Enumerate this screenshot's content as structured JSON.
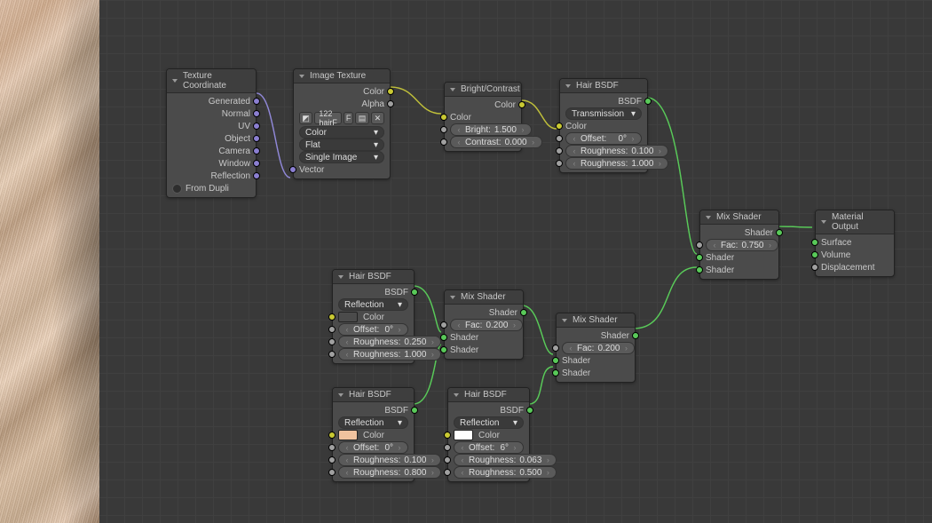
{
  "colors": {
    "swatch_hair1": "#e7d4a6",
    "swatch_hair2": "#f0c29e",
    "swatch_hair3": "#ffffff"
  },
  "nodes": {
    "tex_coord": {
      "title": "Texture Coordinate",
      "outs": [
        "Generated",
        "Normal",
        "UV",
        "Object",
        "Camera",
        "Window",
        "Reflection"
      ],
      "from_dupli": "From Dupli"
    },
    "image_tex": {
      "title": "Image Texture",
      "out_color": "Color",
      "out_alpha": "Alpha",
      "image_name": "122 hairF",
      "f": "F",
      "color_space": "Color",
      "projection": "Flat",
      "source": "Single Image",
      "in_vector": "Vector"
    },
    "bright_contrast": {
      "title": "Bright/Contrast",
      "out_color": "Color",
      "in_color": "Color",
      "bright_label": "Bright:",
      "bright_value": "1.500",
      "contrast_label": "Contrast:",
      "contrast_value": "0.000"
    },
    "hair_transmission": {
      "title": "Hair BSDF",
      "out_bsdf": "BSDF",
      "component": "Transmission",
      "in_color": "Color",
      "offset_label": "Offset:",
      "offset_value": "0°",
      "rough1_label": "Roughness:",
      "rough1_value": "0.100",
      "rough2_label": "Roughness:",
      "rough2_value": "1.000"
    },
    "hair_refl1": {
      "title": "Hair BSDF",
      "out_bsdf": "BSDF",
      "component": "Reflection",
      "in_color": "Color",
      "offset_label": "Offset:",
      "offset_value": "0°",
      "rough1_label": "Roughness:",
      "rough1_value": "0.250",
      "rough2_label": "Roughness:",
      "rough2_value": "1.000"
    },
    "hair_refl2": {
      "title": "Hair BSDF",
      "out_bsdf": "BSDF",
      "component": "Reflection",
      "in_color": "Color",
      "offset_label": "Offset:",
      "offset_value": "0°",
      "rough1_label": "Roughness:",
      "rough1_value": "0.100",
      "rough2_label": "Roughness:",
      "rough2_value": "0.800"
    },
    "hair_refl3": {
      "title": "Hair BSDF",
      "out_bsdf": "BSDF",
      "component": "Reflection",
      "in_color": "Color",
      "offset_label": "Offset:",
      "offset_value": "6°",
      "rough1_label": "Roughness:",
      "rough1_value": "0.063",
      "rough2_label": "Roughness:",
      "rough2_value": "0.500"
    },
    "mix1": {
      "title": "Mix Shader",
      "out_shader": "Shader",
      "fac_label": "Fac:",
      "fac_value": "0.200",
      "in_shader1": "Shader",
      "in_shader2": "Shader"
    },
    "mix2": {
      "title": "Mix Shader",
      "out_shader": "Shader",
      "fac_label": "Fac:",
      "fac_value": "0.200",
      "in_shader1": "Shader",
      "in_shader2": "Shader"
    },
    "mix3": {
      "title": "Mix Shader",
      "out_shader": "Shader",
      "fac_label": "Fac:",
      "fac_value": "0.750",
      "in_shader1": "Shader",
      "in_shader2": "Shader"
    },
    "material_output": {
      "title": "Material Output",
      "surface": "Surface",
      "volume": "Volume",
      "displacement": "Displacement"
    }
  }
}
